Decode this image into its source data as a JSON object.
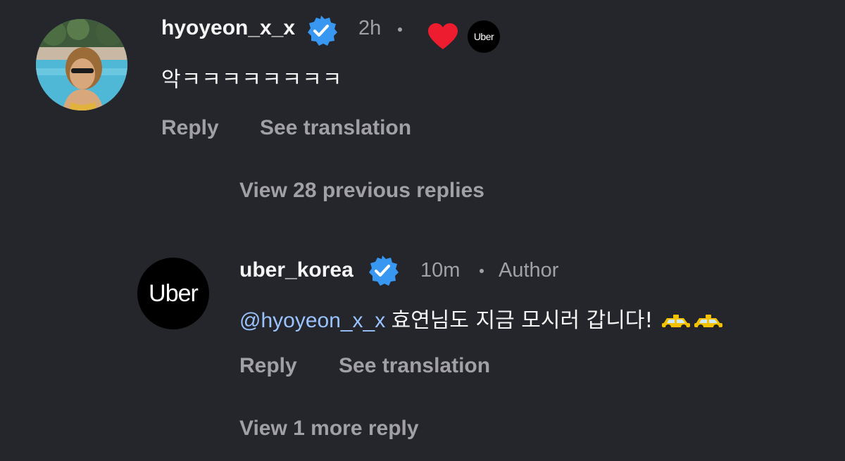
{
  "colors": {
    "background": "#25262b",
    "text": "#f5f5f5",
    "muted": "#a0a0a5",
    "mention": "#9ac2ff",
    "verified": "#3897f0",
    "heart": "#ed1c2e"
  },
  "comment": {
    "username": "hyoyeon_x_x",
    "verified_icon": "verified-badge-icon",
    "time": "2h",
    "liked_by_author_icon": "heart-icon",
    "author_avatar_label": "Uber",
    "text": "악ㅋㅋㅋㅋㅋㅋㅋㅋ",
    "reply_label": "Reply",
    "translate_label": "See translation"
  },
  "view_previous_label": "View 28 previous replies",
  "reply": {
    "avatar_label": "Uber",
    "username": "uber_korea",
    "verified_icon": "verified-badge-icon",
    "time": "10m",
    "author_tag": "Author",
    "mention": "@hyoyeon_x_x",
    "text": "효연님도 지금 모시러 갑니다!",
    "emoji_icons": [
      "taxi-icon",
      "taxi-icon"
    ],
    "reply_label": "Reply",
    "translate_label": "See translation"
  },
  "view_more_label": "View 1 more reply"
}
